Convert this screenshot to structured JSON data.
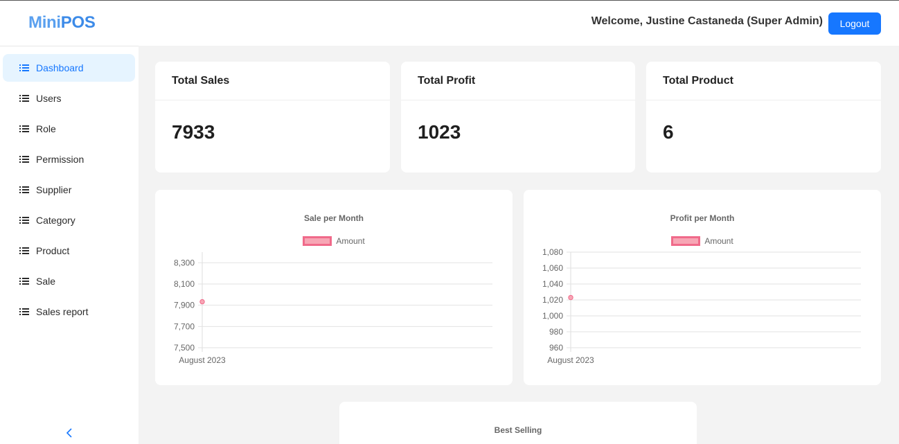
{
  "header": {
    "logo_part1": "Mini",
    "logo_part2": "POS",
    "welcome": "Welcome, Justine Castaneda (Super Admin)",
    "logout_label": "Logout"
  },
  "sidebar": {
    "items": [
      {
        "label": "Dashboard"
      },
      {
        "label": "Users"
      },
      {
        "label": "Role"
      },
      {
        "label": "Permission"
      },
      {
        "label": "Supplier"
      },
      {
        "label": "Category"
      },
      {
        "label": "Product"
      },
      {
        "label": "Sale"
      },
      {
        "label": "Sales report"
      }
    ],
    "collapse_glyph": "<"
  },
  "stats": [
    {
      "title": "Total Sales",
      "value": "7933"
    },
    {
      "title": "Total Profit",
      "value": "1023"
    },
    {
      "title": "Total Product",
      "value": "6"
    }
  ],
  "colors": {
    "accent": "#1677ff",
    "series_fill": "#f7a6b5",
    "series_border": "#f06a8a"
  },
  "chart_data": [
    {
      "type": "line",
      "title": "Sale per Month",
      "categories": [
        "August 2023"
      ],
      "series": [
        {
          "name": "Amount",
          "values": [
            7933
          ]
        }
      ],
      "ylim": [
        7500,
        8400
      ],
      "yticks": [
        "8,300",
        "8,100",
        "7,900",
        "7,700",
        "7,500"
      ],
      "grid": true,
      "legend": "top"
    },
    {
      "type": "line",
      "title": "Profit per Month",
      "categories": [
        "August 2023"
      ],
      "series": [
        {
          "name": "Amount",
          "values": [
            1023
          ]
        }
      ],
      "ylim": [
        960,
        1080
      ],
      "yticks": [
        "1,080",
        "1,060",
        "1,040",
        "1,020",
        "1,000",
        "980",
        "960"
      ],
      "grid": true,
      "legend": "top"
    },
    {
      "type": "bar",
      "title": "Best Selling"
    }
  ]
}
